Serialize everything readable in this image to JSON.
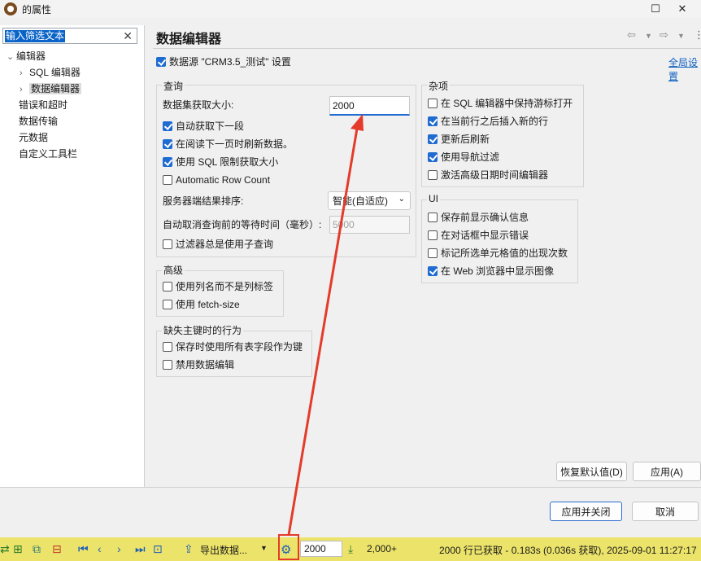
{
  "window": {
    "title": "的属性",
    "maximize_glyph": "☐",
    "close_glyph": "✕"
  },
  "sidebar": {
    "filter_text": "输入筛选文本",
    "clear_glyph": "✕",
    "items": [
      {
        "label": "编辑器",
        "expanded": true
      },
      {
        "label": "SQL 编辑器"
      },
      {
        "label": "数据编辑器",
        "selected": true
      },
      {
        "label": "错误和超时"
      },
      {
        "label": "数据传输"
      },
      {
        "label": "元数据"
      },
      {
        "label": "自定义工具栏"
      }
    ]
  },
  "page": {
    "title": "数据编辑器",
    "datasource_label": "数据源 \"CRM3.5_测试\" 设置",
    "global_settings_link": "全局设置"
  },
  "query_group": {
    "title": "查询",
    "fetch_size_label": "数据集获取大小:",
    "fetch_size_value": "2000",
    "auto_fetch_next": "自动获取下一段",
    "refresh_on_next_page": "在阅读下一页时刷新数据。",
    "use_sql_limit": "使用 SQL 限制获取大小",
    "auto_row_count": "Automatic Row Count",
    "server_sort_label": "服务器端结果排序:",
    "server_sort_value": "智能(自适应)",
    "auto_cancel_label": "自动取消查询前的等待时间（毫秒）:",
    "auto_cancel_value": "5000",
    "filter_subquery": "过滤器总是使用子查询"
  },
  "advanced_group": {
    "title": "高级",
    "use_column_names": "使用列名而不是列标签",
    "use_fetch_size": "使用 fetch-size"
  },
  "missing_key_group": {
    "title": "缺失主键时的行为",
    "use_all_columns": "保存时使用所有表字段作为键",
    "disable_editing": "禁用数据编辑"
  },
  "misc_group": {
    "title": "杂项",
    "keep_cursor": "在 SQL 编辑器中保持游标打开",
    "insert_after_current": "在当前行之后插入新的行",
    "refresh_after_update": "更新后刷新",
    "use_nav_filter": "使用导航过滤",
    "advanced_date_editor": "激活高级日期时间编辑器"
  },
  "ui_group": {
    "title": "UI",
    "confirm_before_save": "保存前显示确认信息",
    "show_errors_in_dialog": "在对话框中显示错误",
    "mark_cell_occurrences": "标记所选单元格值的出现次数",
    "show_images_in_browser": "在 Web 浏览器中显示图像"
  },
  "buttons": {
    "restore_defaults": "恢复默认值(D)",
    "apply": "应用(A)",
    "apply_and_close": "应用并关闭",
    "cancel": "取消"
  },
  "statusbar": {
    "export_label": "导出数据...",
    "fetch_size_value": "2000",
    "fetch_more_label": "2,000+",
    "status_text": "2000 行已获取 - 0.183s (0.036s 获取), 2025-09-01 11:27:17"
  },
  "colors": {
    "accent": "#1f6bd1",
    "statusbar_bg": "#ece46a",
    "annotation_red": "#e43b2a"
  }
}
